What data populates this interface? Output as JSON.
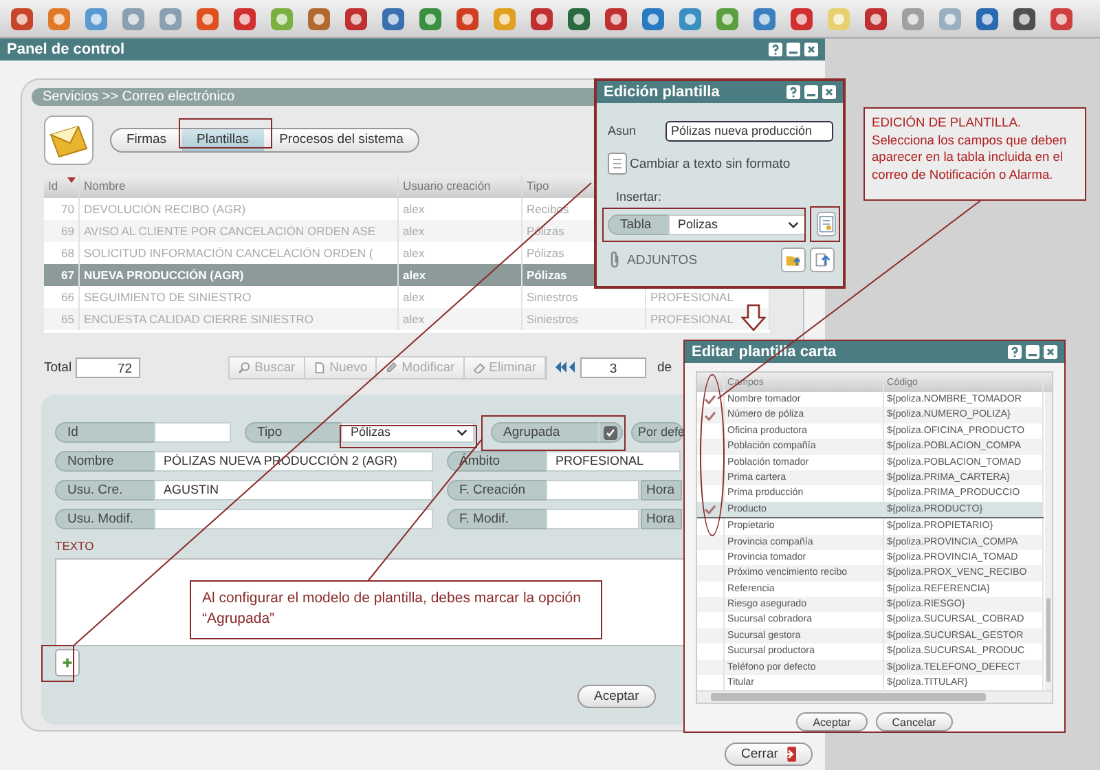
{
  "window": {
    "title": "Panel de control"
  },
  "breadcrumb": "Servicios >> Correo electrónico",
  "tabs": [
    {
      "label": "Firmas",
      "selected": false
    },
    {
      "label": "Plantillas",
      "selected": true
    },
    {
      "label": "Procesos del sistema",
      "selected": false
    }
  ],
  "table": {
    "columns": [
      "Id",
      "Nombre",
      "Usuario creación",
      "Tipo"
    ],
    "rows": [
      {
        "id": "70",
        "name": "DEVOLUCIÓN RECIBO (AGR)",
        "user": "alex",
        "type": "Recibos",
        "selected": false
      },
      {
        "id": "69",
        "name": "AVISO AL CLIENTE POR CANCELACIÓN ORDEN ASE",
        "user": "alex",
        "type": "Pólizas",
        "selected": false
      },
      {
        "id": "68",
        "name": "SOLICITUD INFORMACIÓN CANCELACIÓN ORDEN (",
        "user": "alex",
        "type": "Pólizas",
        "selected": false
      },
      {
        "id": "67",
        "name": "NUEVA PRODUCCIÓN (AGR)",
        "user": "alex",
        "type": "Pólizas",
        "selected": true
      },
      {
        "id": "66",
        "name": "SEGUIMIENTO DE SINIESTRO",
        "user": "alex",
        "type": "Siniestros",
        "column_5": "PROFESIONAL",
        "selected": false
      },
      {
        "id": "65",
        "name": "ENCUESTA CALIDAD CIERRE SINIESTRO",
        "user": "alex",
        "type": "Siniestros",
        "column_5": "PROFESIONAL",
        "selected": false
      }
    ]
  },
  "pager": {
    "total_label": "Total",
    "total": "72",
    "actions": [
      {
        "label": "Buscar",
        "disabled": true
      },
      {
        "label": "Nuevo",
        "disabled": true
      },
      {
        "label": "Modificar",
        "disabled": true
      },
      {
        "label": "Eliminar",
        "disabled": true
      }
    ],
    "page": "3",
    "of_label": "de"
  },
  "form": {
    "rows": [
      {
        "fields": [
          {
            "kind": "text",
            "label": "Id"
          },
          {
            "kind": "select",
            "label": "Tipo",
            "value": "Pólizas"
          },
          {
            "kind": "checkbox",
            "label": "Agrupada",
            "checked": true
          },
          {
            "kind": "label",
            "label": "Por defe"
          }
        ]
      },
      {
        "fields": [
          {
            "kind": "text",
            "label": "Nombre",
            "value": "PÓLIZAS NUEVA PRODUCCIÓN 2 (AGR)"
          },
          {
            "kind": "text",
            "label": "Ámbito",
            "value": "PROFESIONAL"
          }
        ]
      },
      {
        "fields": [
          {
            "kind": "text",
            "label": "Usu. Cre.",
            "value": "AGUSTIN"
          },
          {
            "kind": "text",
            "label": "F. Creación"
          },
          {
            "kind": "label",
            "label": "Hora"
          }
        ]
      },
      {
        "fields": [
          {
            "kind": "text",
            "label": "Usu. Modif."
          },
          {
            "kind": "text",
            "label": "F. Modif."
          },
          {
            "kind": "label",
            "label": "Hora"
          }
        ]
      }
    ],
    "text_label": "TEXTO",
    "buttons": [
      "Aceptar"
    ]
  },
  "close_button": "Cerrar",
  "template_dialog": {
    "title": "Edición plantilla",
    "subject_label": "Asun",
    "subject": "Pólizas nueva producción",
    "plain_text_button": "Cambiar a texto sin formato",
    "insert_label": "Insertar:",
    "table_label": "Tabla",
    "table_value": "Polizas",
    "attachments_label": "ADJUNTOS"
  },
  "callouts": [
    {
      "title": "EDICIÓN DE PLANTILLA.",
      "text": "Selecciona los campos que deben aparecer en la tabla incluida en el correo de Notificación o Alarma."
    },
    {
      "text": "Al configurar el modelo de plantilla, debes marcar la opción “Agrupada”"
    }
  ],
  "fields_dialog": {
    "title": "Editar plantilla carta",
    "columns": [
      "Campos",
      "Código"
    ],
    "rows": [
      {
        "field": "Nombre tomador",
        "code": "${poliza.NOMBRE_TOMADOR",
        "checked": true,
        "selected": false
      },
      {
        "field": "Número de póliza",
        "code": "${poliza.NUMERO_POLIZA}",
        "checked": true,
        "selected": false
      },
      {
        "field": "Oficina productora",
        "code": "${poliza.OFICINA_PRODUCTO",
        "checked": false,
        "selected": false
      },
      {
        "field": "Población compañía",
        "code": "${poliza.POBLACION_COMPA",
        "checked": false,
        "selected": false
      },
      {
        "field": "Población tomador",
        "code": "${poliza.POBLACION_TOMAD",
        "checked": false,
        "selected": false
      },
      {
        "field": "Prima cartera",
        "code": "${poliza.PRIMA_CARTERA}",
        "checked": false,
        "selected": false
      },
      {
        "field": "Prima producción",
        "code": "${poliza.PRIMA_PRODUCCIO",
        "checked": false,
        "selected": false
      },
      {
        "field": "Producto",
        "code": "${poliza.PRODUCTO}",
        "checked": true,
        "selected": true
      },
      {
        "field": "Propietario",
        "code": "${poliza.PROPIETARIO}",
        "checked": false,
        "selected": false
      },
      {
        "field": "Provincia compañía",
        "code": "${poliza.PROVINCIA_COMPA",
        "checked": false,
        "selected": false
      },
      {
        "field": "Provincia tomador",
        "code": "${poliza.PROVINCIA_TOMAD",
        "checked": false,
        "selected": false
      },
      {
        "field": "Próximo vencimiento recibo",
        "code": "${poliza.PROX_VENC_RECIBO",
        "checked": false,
        "selected": false
      },
      {
        "field": "Referencia",
        "code": "${poliza.REFERENCIA}",
        "checked": false,
        "selected": false
      },
      {
        "field": "Riesgo asegurado",
        "code": "${poliza.RIESGO}",
        "checked": false,
        "selected": false
      },
      {
        "field": "Sucursal cobradora",
        "code": "${poliza.SUCURSAL_COBRAD",
        "checked": false,
        "selected": false
      },
      {
        "field": "Sucursal gestora",
        "code": "${poliza.SUCURSAL_GESTOR",
        "checked": false,
        "selected": false
      },
      {
        "field": "Sucursal productora",
        "code": "${poliza.SUCURSAL_PRODUC",
        "checked": false,
        "selected": false
      },
      {
        "field": "Teléfono por defecto",
        "code": "${poliza.TELEFONO_DEFECT",
        "checked": false,
        "selected": false
      },
      {
        "field": "Titular",
        "code": "${poliza.TITULAR}",
        "checked": false,
        "selected": false
      }
    ],
    "buttons": [
      "Aceptar",
      "Cancelar"
    ]
  }
}
